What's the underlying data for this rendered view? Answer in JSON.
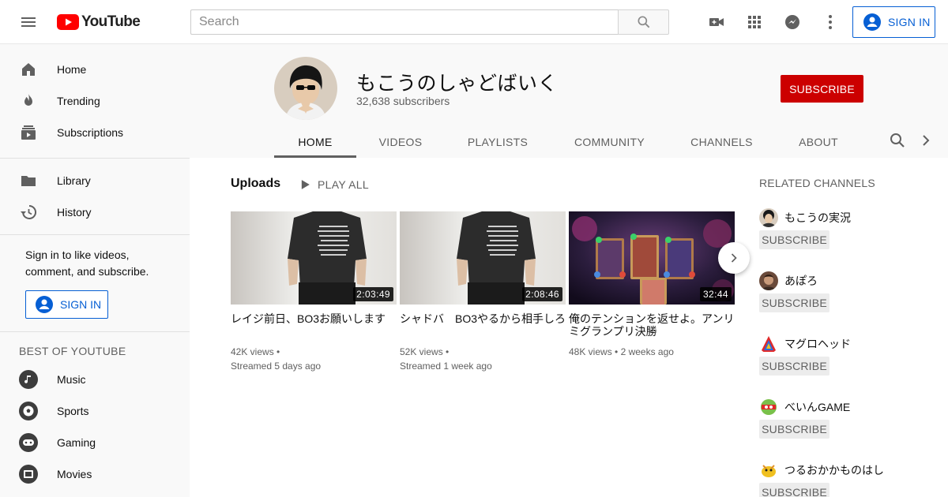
{
  "topbar": {
    "logo_text": "YouTube",
    "search_placeholder": "Search",
    "signin_label": "SIGN IN"
  },
  "sidebar": {
    "items": [
      {
        "label": "Home",
        "icon": "home-icon"
      },
      {
        "label": "Trending",
        "icon": "flame-icon"
      },
      {
        "label": "Subscriptions",
        "icon": "subscriptions-icon"
      },
      {
        "label": "Library",
        "icon": "folder-icon"
      },
      {
        "label": "History",
        "icon": "history-icon"
      }
    ],
    "signin_prompt": "Sign in to like videos, comment, and subscribe.",
    "signin_label": "SIGN IN",
    "best_heading": "BEST OF YOUTUBE",
    "best_items": [
      {
        "label": "Music",
        "icon": "music-icon"
      },
      {
        "label": "Sports",
        "icon": "sports-icon"
      },
      {
        "label": "Gaming",
        "icon": "gaming-icon"
      },
      {
        "label": "Movies",
        "icon": "movies-icon"
      }
    ]
  },
  "channel": {
    "name": "もこうのしゃどばいく",
    "subscribers": "32,638 subscribers",
    "subscribe_label": "SUBSCRIBE",
    "tabs": [
      "HOME",
      "VIDEOS",
      "PLAYLISTS",
      "COMMUNITY",
      "CHANNELS",
      "ABOUT"
    ],
    "active_tab": "HOME"
  },
  "uploads": {
    "title": "Uploads",
    "play_all": "PLAY ALL",
    "videos": [
      {
        "title": "レイジ前日、BO3お願いします",
        "duration": "2:03:49",
        "views": "42K views",
        "age": "Streamed 5 days ago"
      },
      {
        "title": "シャドバ　BO3やるから相手しろ",
        "duration": "2:08:46",
        "views": "52K views",
        "age": "Streamed 1 week ago"
      },
      {
        "title": "俺のテンションを返せよ。アンリミグランプリ決勝",
        "duration": "32:44",
        "views": "48K views",
        "age": "2 weeks ago"
      }
    ]
  },
  "related": {
    "title": "RELATED CHANNELS",
    "subscribe_label": "SUBSCRIBE",
    "channels": [
      {
        "name": "もこうの実況"
      },
      {
        "name": "あぽろ"
      },
      {
        "name": "マグロヘッド"
      },
      {
        "name": "べいんGAME"
      },
      {
        "name": "つるおかかものはし"
      }
    ]
  },
  "colors": {
    "brand_red": "#ff0000",
    "subscribe_red": "#cc0000",
    "link_blue": "#065fd4"
  }
}
